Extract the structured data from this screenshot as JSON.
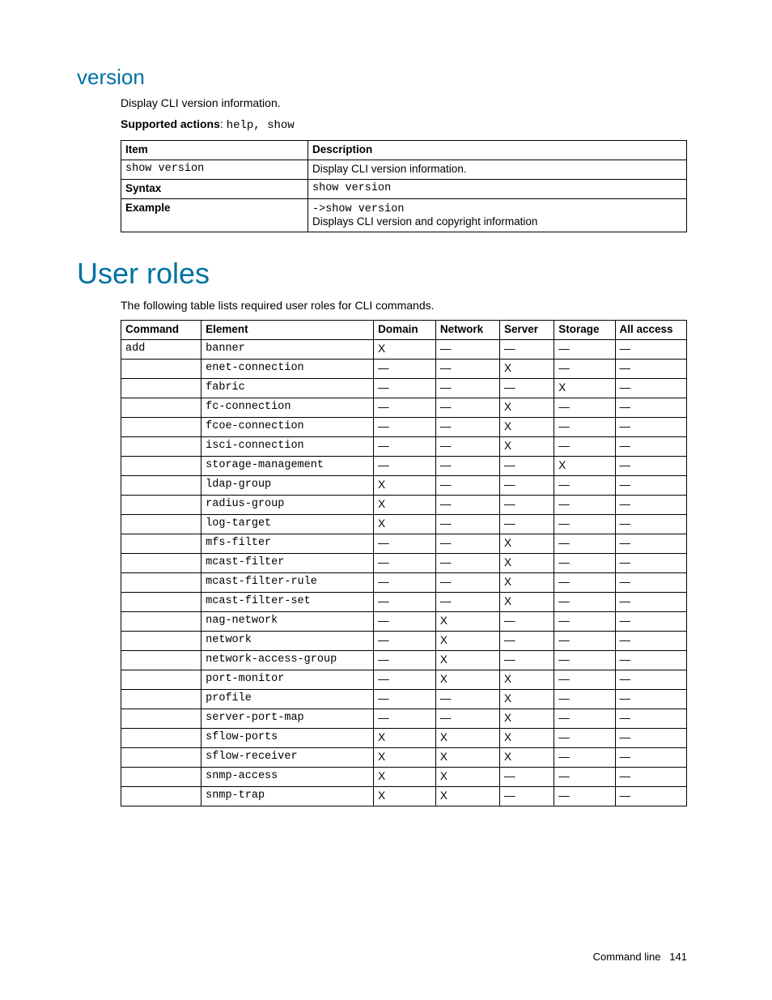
{
  "version_section": {
    "heading": "version",
    "intro": "Display CLI version information.",
    "supported_label": "Supported actions",
    "supported_value": "help, show",
    "table": {
      "hdr_item": "Item",
      "hdr_desc": "Description",
      "row_item": "show version",
      "row_desc": "Display CLI version information.",
      "syntax_label": "Syntax",
      "syntax_value": "show version",
      "example_label": "Example",
      "example_cmd": "->show version",
      "example_text": "Displays CLI version and copyright information"
    }
  },
  "roles_section": {
    "heading": "User roles",
    "intro": "The following table lists required user roles for CLI commands.",
    "hdr": {
      "command": "Command",
      "element": "Element",
      "domain": "Domain",
      "network": "Network",
      "server": "Server",
      "storage": "Storage",
      "all": "All access"
    },
    "cmd_add": "add",
    "dash": "—",
    "x": "X",
    "rows": [
      {
        "element": "banner",
        "d": "X",
        "n": "—",
        "s": "—",
        "t": "—",
        "a": "—"
      },
      {
        "element": "enet-connection",
        "d": "—",
        "n": "—",
        "s": "X",
        "t": "—",
        "a": "—"
      },
      {
        "element": "fabric",
        "d": "—",
        "n": "—",
        "s": "—",
        "t": "X",
        "a": "—"
      },
      {
        "element": "fc-connection",
        "d": "—",
        "n": "—",
        "s": "X",
        "t": "—",
        "a": "—"
      },
      {
        "element": "fcoe-connection",
        "d": "—",
        "n": "—",
        "s": "X",
        "t": "—",
        "a": "—"
      },
      {
        "element": "isci-connection",
        "d": "—",
        "n": "—",
        "s": "X",
        "t": "—",
        "a": "—"
      },
      {
        "element": "storage-management",
        "d": "—",
        "n": "—",
        "s": "—",
        "t": "X",
        "a": "—"
      },
      {
        "element": "ldap-group",
        "d": "X",
        "n": "—",
        "s": "—",
        "t": "—",
        "a": "—"
      },
      {
        "element": "radius-group",
        "d": "X",
        "n": "—",
        "s": "—",
        "t": "—",
        "a": "—"
      },
      {
        "element": "log-target",
        "d": "X",
        "n": "—",
        "s": "—",
        "t": "—",
        "a": "—"
      },
      {
        "element": "mfs-filter",
        "d": "—",
        "n": "—",
        "s": "X",
        "t": "—",
        "a": "—"
      },
      {
        "element": "mcast-filter",
        "d": "—",
        "n": "—",
        "s": "X",
        "t": "—",
        "a": "—"
      },
      {
        "element": "mcast-filter-rule",
        "d": "—",
        "n": "—",
        "s": "X",
        "t": "—",
        "a": "—"
      },
      {
        "element": "mcast-filter-set",
        "d": "—",
        "n": "—",
        "s": "X",
        "t": "—",
        "a": "—"
      },
      {
        "element": "nag-network",
        "d": "—",
        "n": "X",
        "s": "—",
        "t": "—",
        "a": "—"
      },
      {
        "element": "network",
        "d": "—",
        "n": "X",
        "s": "—",
        "t": "—",
        "a": "—"
      },
      {
        "element": "network-access-group",
        "d": "—",
        "n": "X",
        "s": "—",
        "t": "—",
        "a": "—"
      },
      {
        "element": "port-monitor",
        "d": "—",
        "n": "X",
        "s": "X",
        "t": "—",
        "a": "—"
      },
      {
        "element": "profile",
        "d": "—",
        "n": "—",
        "s": "X",
        "t": "—",
        "a": "—"
      },
      {
        "element": "server-port-map",
        "d": "—",
        "n": "—",
        "s": "X",
        "t": "—",
        "a": "—"
      },
      {
        "element": "sflow-ports",
        "d": "X",
        "n": "X",
        "s": "X",
        "t": "—",
        "a": "—"
      },
      {
        "element": "sflow-receiver",
        "d": "X",
        "n": "X",
        "s": "X",
        "t": "—",
        "a": "—"
      },
      {
        "element": "snmp-access",
        "d": "X",
        "n": "X",
        "s": "—",
        "t": "—",
        "a": "—"
      },
      {
        "element": "snmp-trap",
        "d": "X",
        "n": "X",
        "s": "—",
        "t": "—",
        "a": "—"
      }
    ]
  },
  "footer": {
    "label": "Command line",
    "page": "141"
  }
}
